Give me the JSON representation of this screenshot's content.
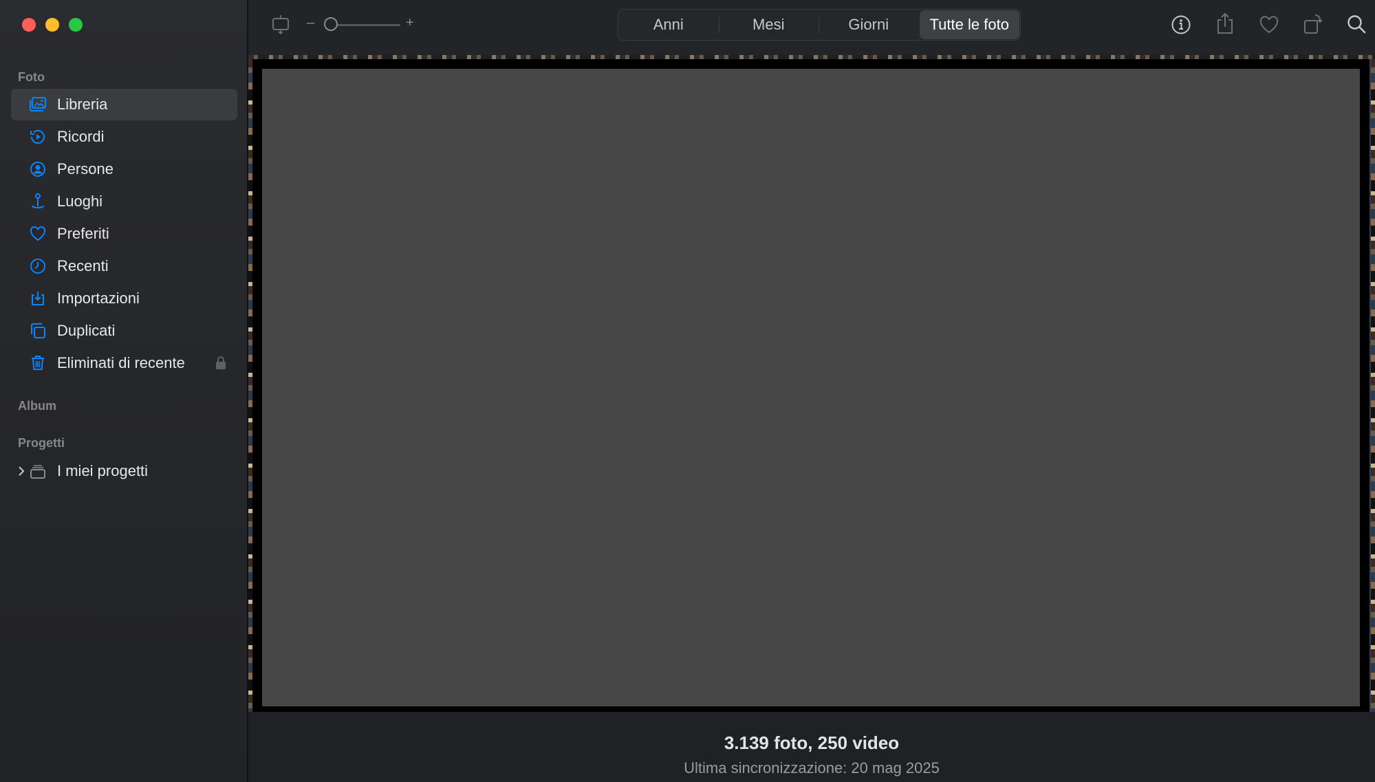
{
  "sidebar": {
    "sections": {
      "foto": "Foto",
      "album": "Album",
      "progetti": "Progetti"
    },
    "items": [
      {
        "label": "Libreria",
        "icon": "library-icon",
        "selected": true
      },
      {
        "label": "Ricordi",
        "icon": "memories-icon"
      },
      {
        "label": "Persone",
        "icon": "people-icon"
      },
      {
        "label": "Luoghi",
        "icon": "places-icon"
      },
      {
        "label": "Preferiti",
        "icon": "heart-icon"
      },
      {
        "label": "Recenti",
        "icon": "clock-icon"
      },
      {
        "label": "Importazioni",
        "icon": "import-icon"
      },
      {
        "label": "Duplicati",
        "icon": "duplicates-icon"
      },
      {
        "label": "Eliminati di recente",
        "icon": "trash-icon",
        "locked": true
      }
    ],
    "projects": [
      {
        "label": "I miei progetti",
        "icon": "folder-icon"
      }
    ]
  },
  "toolbar": {
    "zoom_minus": "–",
    "zoom_plus": "+",
    "tabs": [
      {
        "label": "Anni"
      },
      {
        "label": "Mesi"
      },
      {
        "label": "Giorni"
      },
      {
        "label": "Tutte le foto",
        "active": true
      }
    ]
  },
  "content": {
    "summary": "3.139 foto, 250 video",
    "sync": "Ultima sincronizzazione: 20 mag 2025"
  },
  "colors": {
    "accent": "#0a84ff",
    "sidebar_bg": "#26272a",
    "selected_bg": "#3b3c40"
  }
}
